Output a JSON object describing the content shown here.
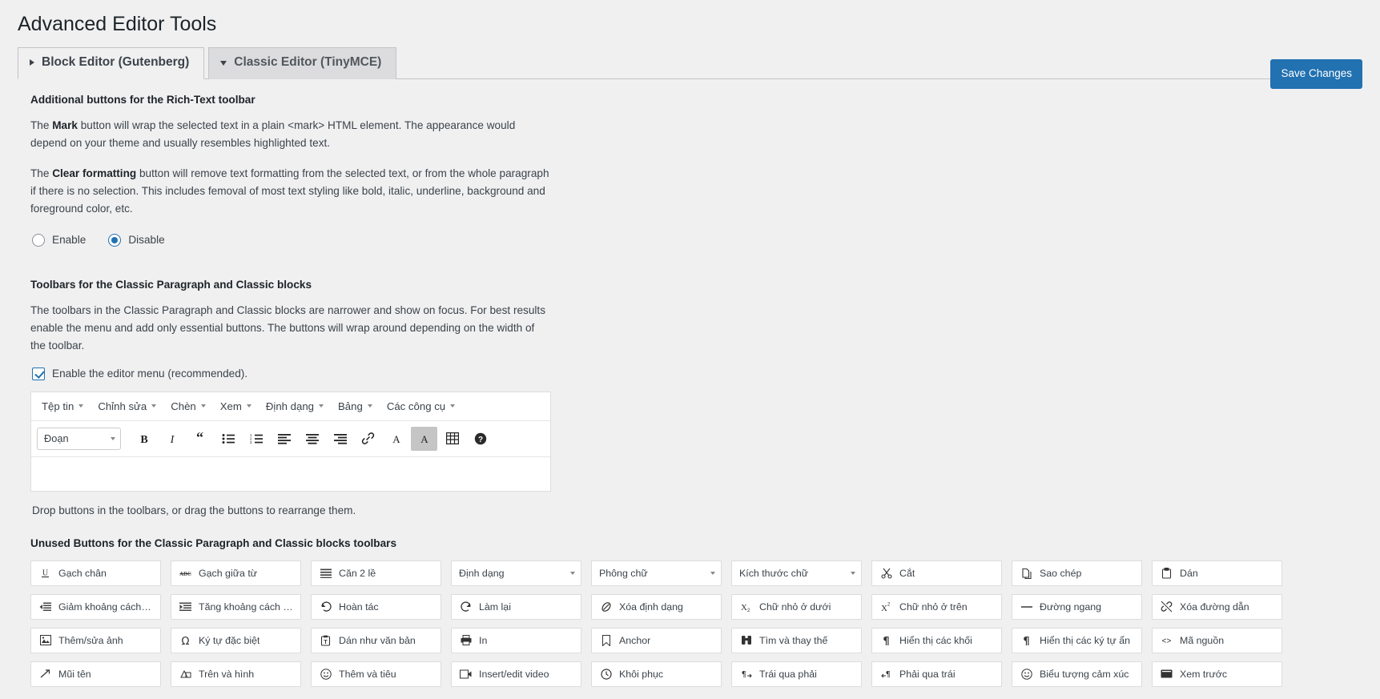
{
  "page": {
    "title": "Advanced Editor Tools"
  },
  "tabs": [
    {
      "label": "Block Editor (Gutenberg)",
      "icon": "triangle-right-icon",
      "active": true
    },
    {
      "label": "Classic Editor (TinyMCE)",
      "icon": "triangle-down-icon",
      "active": false
    }
  ],
  "save_button": {
    "label": "Save Changes",
    "color": "#2271b1"
  },
  "rich_text": {
    "heading": "Additional buttons for the Rich-Text toolbar",
    "p1_pre": "The ",
    "p1_bold": "Mark",
    "p1_post": " button will wrap the selected text in a plain <mark> HTML element. The appearance would depend on your theme and usually resembles highlighted text.",
    "p2_pre": "The ",
    "p2_bold": "Clear formatting",
    "p2_post": " button will remove text formatting from the selected text, or from the whole paragraph if there is no selection. This includes femoval of most text styling like bold, italic, underline, background and foreground color, etc.",
    "radios": [
      {
        "label": "Enable",
        "checked": false
      },
      {
        "label": "Disable",
        "checked": true
      }
    ]
  },
  "toolbars": {
    "heading": "Toolbars for the Classic Paragraph and Classic blocks",
    "description": "The toolbars in the Classic Paragraph and Classic blocks are narrower and show on focus. For best results enable the menu and add only essential buttons. The buttons will wrap around depending on the width of the toolbar.",
    "checkbox_label": "Enable the editor menu (recommended).",
    "checkbox_checked": true,
    "menubar": [
      {
        "label": "Tệp tin",
        "name": "menu-file"
      },
      {
        "label": "Chỉnh sửa",
        "name": "menu-edit"
      },
      {
        "label": "Chèn",
        "name": "menu-insert"
      },
      {
        "label": "Xem",
        "name": "menu-view"
      },
      {
        "label": "Định dạng",
        "name": "menu-format"
      },
      {
        "label": "Bảng",
        "name": "menu-table"
      },
      {
        "label": "Các công cụ",
        "name": "menu-tools"
      }
    ],
    "format_select_value": "Đoạn",
    "buttons": [
      {
        "icon": "bold-icon",
        "name": "bold"
      },
      {
        "icon": "italic-icon",
        "name": "italic"
      },
      {
        "icon": "blockquote-icon",
        "name": "blockquote"
      },
      {
        "icon": "bullet-list-icon",
        "name": "bullist"
      },
      {
        "icon": "numbered-list-icon",
        "name": "numlist"
      },
      {
        "icon": "align-left-icon",
        "name": "alignleft"
      },
      {
        "icon": "align-center-icon",
        "name": "aligncenter"
      },
      {
        "icon": "align-right-icon",
        "name": "alignright"
      },
      {
        "icon": "link-icon",
        "name": "link"
      },
      {
        "icon": "text-color-icon",
        "name": "forecolor"
      },
      {
        "icon": "background-color-icon",
        "name": "backcolor",
        "selected": true
      },
      {
        "icon": "table-icon",
        "name": "table"
      },
      {
        "icon": "help-icon",
        "name": "help"
      }
    ],
    "drop_hint": "Drop buttons in the toolbars, or drag the buttons to rearrange them."
  },
  "unused": {
    "heading": "Unused Buttons for the Classic Paragraph and Classic blocks toolbars",
    "buttons": [
      {
        "label": "Gạch chân",
        "icon": "underline-icon",
        "type": "button"
      },
      {
        "label": "Gạch giữa từ",
        "icon": "strikethrough-icon",
        "type": "button"
      },
      {
        "label": "Căn 2 lề",
        "icon": "justify-icon",
        "type": "button"
      },
      {
        "label": "Định dạng",
        "icon": "",
        "type": "select"
      },
      {
        "label": "Phông chữ",
        "icon": "",
        "type": "select"
      },
      {
        "label": "Kích thước chữ",
        "icon": "",
        "type": "select"
      },
      {
        "label": "Cắt",
        "icon": "scissors-icon",
        "type": "button"
      },
      {
        "label": "Sao chép",
        "icon": "copy-icon",
        "type": "button"
      },
      {
        "label": "Dán",
        "icon": "paste-icon",
        "type": "button"
      },
      {
        "label": "Giảm khoảng cách t...",
        "icon": "outdent-icon",
        "type": "button"
      },
      {
        "label": "Tăng khoảng cách t...",
        "icon": "indent-icon",
        "type": "button"
      },
      {
        "label": "Hoàn tác",
        "icon": "undo-icon",
        "type": "button"
      },
      {
        "label": "Làm lại",
        "icon": "redo-icon",
        "type": "button"
      },
      {
        "label": "Xóa định dạng",
        "icon": "eraser-icon",
        "type": "button"
      },
      {
        "label": "Chữ nhỏ ở dưới",
        "icon": "subscript-icon",
        "type": "button"
      },
      {
        "label": "Chữ nhỏ ở trên",
        "icon": "superscript-icon",
        "type": "button"
      },
      {
        "label": "Đường ngang",
        "icon": "horizontal-rule-icon",
        "type": "button"
      },
      {
        "label": "Xóa đường dẫn",
        "icon": "unlink-icon",
        "type": "button"
      },
      {
        "label": "Thêm/sửa ảnh",
        "icon": "image-icon",
        "type": "button"
      },
      {
        "label": "Ký tự đặc biệt",
        "icon": "omega-icon",
        "type": "button"
      },
      {
        "label": "Dán như văn bản",
        "icon": "paste-text-icon",
        "type": "button"
      },
      {
        "label": "In",
        "icon": "printer-icon",
        "type": "button"
      },
      {
        "label": "Anchor",
        "icon": "anchor-bookmark-icon",
        "type": "button"
      },
      {
        "label": "Tìm và thay thế",
        "icon": "binoculars-icon",
        "type": "button"
      },
      {
        "label": "Hiển thị các khối",
        "icon": "pilcrow-icon",
        "type": "button"
      },
      {
        "label": "Hiển thị các ký tự ẩn",
        "icon": "pilcrow-icon",
        "type": "button"
      },
      {
        "label": "Mã nguồn",
        "icon": "code-icon",
        "type": "button"
      },
      {
        "label": "Mũi tên",
        "icon": "arrow-icon",
        "type": "button"
      },
      {
        "label": "Trên và hình",
        "icon": "shapes-icon",
        "type": "button"
      },
      {
        "label": "Thêm và tiêu",
        "icon": "emoji-icon",
        "type": "button"
      },
      {
        "label": "Insert/edit video",
        "icon": "video-icon",
        "type": "button"
      },
      {
        "label": "Khôi phục",
        "icon": "restore-icon",
        "type": "button"
      },
      {
        "label": "Trái qua phải",
        "icon": "ltr-icon",
        "type": "button"
      },
      {
        "label": "Phải qua trái",
        "icon": "rtl-icon",
        "type": "button"
      },
      {
        "label": "Biểu tượng cảm xúc",
        "icon": "smiley-icon",
        "type": "button"
      },
      {
        "label": "Xem trước",
        "icon": "preview-icon",
        "type": "button"
      }
    ]
  }
}
